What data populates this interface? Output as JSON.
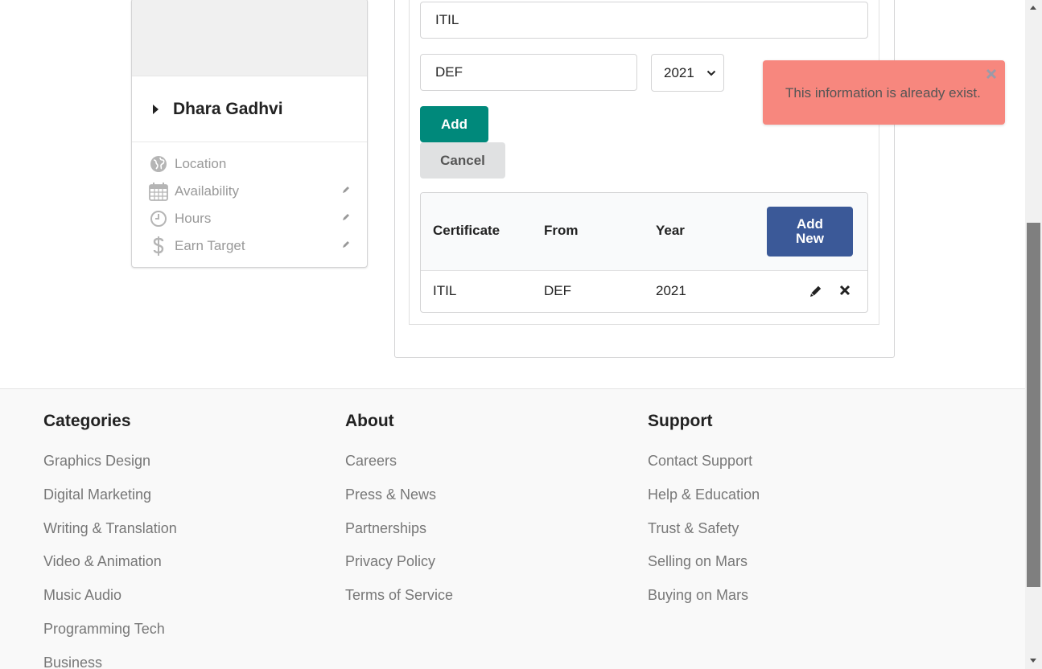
{
  "profile": {
    "name": "Dhara Gadhvi",
    "items": [
      {
        "label": "Location",
        "icon": "globe-icon",
        "editable": false
      },
      {
        "label": "Availability",
        "icon": "calendar-icon",
        "editable": true
      },
      {
        "label": "Hours",
        "icon": "clock-icon",
        "editable": true
      },
      {
        "label": "Earn Target",
        "icon": "dollar-icon",
        "editable": true
      }
    ]
  },
  "form": {
    "certificate_value": "ITIL",
    "from_value": "DEF",
    "year_value": "2021",
    "add_label": "Add",
    "cancel_label": "Cancel"
  },
  "table": {
    "headers": [
      "Certificate",
      "From",
      "Year"
    ],
    "add_new_line1": "Add",
    "add_new_line2": "New",
    "rows": [
      {
        "certificate": "ITIL",
        "from": "DEF",
        "year": "2021"
      }
    ]
  },
  "toast": {
    "message": "This information is already exist.",
    "color": "#f7877e"
  },
  "footer": {
    "columns": [
      {
        "title": "Categories",
        "links": [
          "Graphics Design",
          "Digital Marketing",
          "Writing & Translation",
          "Video & Animation",
          "Music Audio",
          "Programming Tech",
          "Business"
        ]
      },
      {
        "title": "About",
        "links": [
          "Careers",
          "Press & News",
          "Partnerships",
          "Privacy Policy",
          "Terms of Service"
        ]
      },
      {
        "title": "Support",
        "links": [
          "Contact Support",
          "Help & Education",
          "Trust & Safety",
          "Selling on Mars",
          "Buying on Mars"
        ]
      }
    ]
  },
  "colors": {
    "add_button": "#00897b",
    "add_new_button": "#3b5998",
    "cancel_button": "#e0e1e2"
  }
}
